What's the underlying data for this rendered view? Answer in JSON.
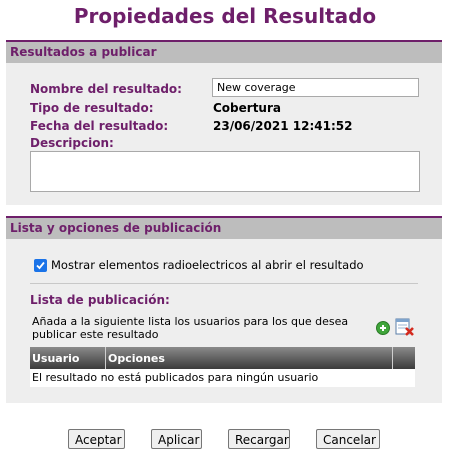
{
  "page": {
    "title": "Propiedades del Resultado"
  },
  "results_section": {
    "heading": "Resultados a publicar",
    "name_label": "Nombre del resultado:",
    "name_value": "New coverage",
    "type_label": "Tipo de resultado:",
    "type_value": "Cobertura",
    "date_label": "Fecha del resultado:",
    "date_value": "23/06/2021 12:41:52",
    "description_label": "Descripcion:",
    "description_value": ""
  },
  "publication_section": {
    "heading": "Lista y opciones de publicación",
    "show_elements_label": "Mostrar elementos radioelectricos al abrir el resultado",
    "show_elements_checked": true,
    "list_label": "Lista de publicación:",
    "list_description": "Añada a la siguiente lista los usuarios para los que desea publicar este resultado",
    "table": {
      "columns": [
        "Usuario",
        "Opciones"
      ],
      "empty_message": "El resultado no está publicados para ningún usuario"
    }
  },
  "buttons": {
    "accept": "Aceptar",
    "apply": "Aplicar",
    "reload": "Recargar",
    "cancel": "Cancelar"
  },
  "colors": {
    "accent": "#6e1f6a",
    "header_gray": "#bdbdbd",
    "panel_gray": "#eeeeee"
  }
}
